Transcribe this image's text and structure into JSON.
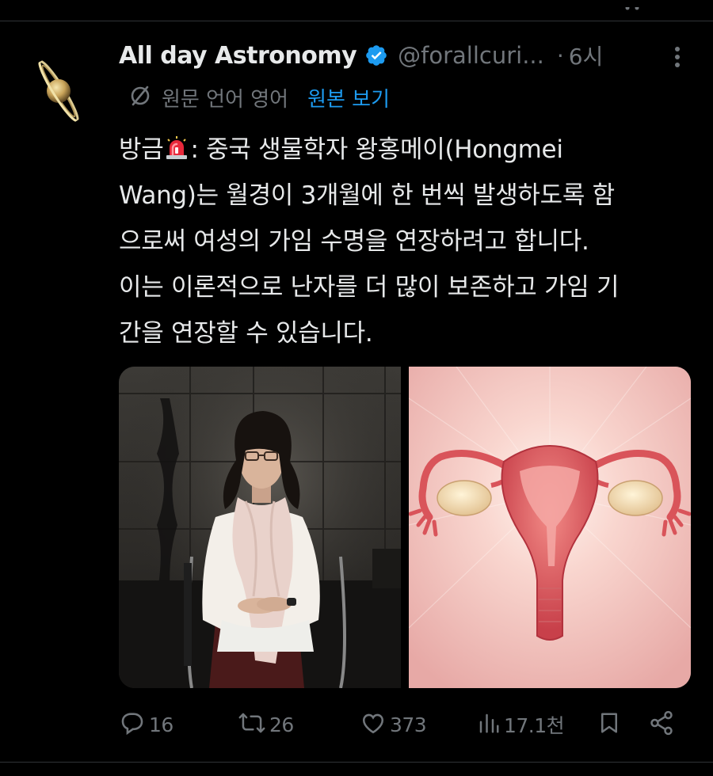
{
  "tweet": {
    "author": {
      "display_name": "All day Astronomy",
      "handle": "@forallcuri...",
      "verified_color": "#1d9bf0",
      "avatar_icon": "saturn-icon"
    },
    "separator": "·",
    "time": "6시",
    "translation": {
      "label": "원문 언어 영어",
      "show_original": "원본 보기"
    },
    "text_lines": [
      {
        "before": "방금",
        "emoji": "siren-icon",
        "after": ": 중국 생물학자 왕홍메이(Hongmei"
      },
      {
        "text": "Wang)는 월경이 3개월에 한 번씩 발생하도록 함"
      },
      {
        "text": "으로써 여성의 가임 수명을 연장하려고 합니다."
      },
      {
        "text": "이는 이론적으로 난자를 더 많이 보존하고 가임 기"
      },
      {
        "text": "간을 연장할 수 있습니다."
      }
    ],
    "media": [
      {
        "kind": "photo",
        "subject": "portrait-photo"
      },
      {
        "kind": "illustration",
        "subject": "uterus-illustration"
      }
    ],
    "actions": {
      "replies": "16",
      "reposts": "26",
      "likes": "373",
      "views": "17.1천"
    },
    "colors": {
      "background": "#000000",
      "text": "#e7e9ea",
      "secondary": "#71767b",
      "accent": "#1d9bf0"
    }
  }
}
